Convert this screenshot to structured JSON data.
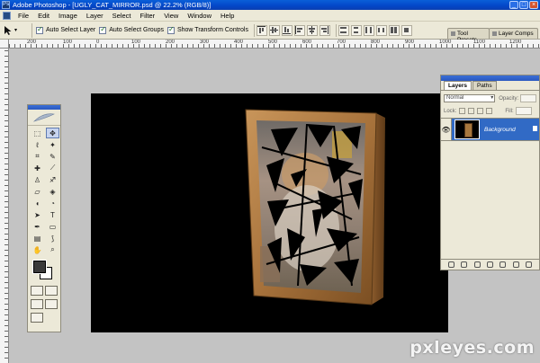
{
  "window": {
    "title": "Adobe Photoshop - [UGLY_CAT_MIRROR.psd @ 22.2% (RGB/8)]"
  },
  "menu": {
    "items": [
      "File",
      "Edit",
      "Image",
      "Layer",
      "Select",
      "Filter",
      "View",
      "Window",
      "Help"
    ]
  },
  "options": {
    "auto_select_layer": "Auto Select Layer",
    "auto_select_groups": "Auto Select Groups",
    "show_transform_controls": "Show Transform Controls",
    "tool_presets_tab": "Tool Presets",
    "layer_comps_tab": "Layer Comps"
  },
  "ruler": {
    "top_labels": [
      "200",
      "100",
      "0",
      "100",
      "200",
      "300",
      "400",
      "500",
      "600",
      "700",
      "800",
      "900",
      "1000",
      "1100",
      "1200"
    ]
  },
  "layers_panel": {
    "tabs": [
      "Layers",
      "Paths"
    ],
    "blend_mode": "Normal",
    "opacity_label": "Opacity:",
    "lock_label": "Lock:",
    "fill_label": "Fill:",
    "layer_name": "Background"
  },
  "colors": {
    "canvas": "#000000",
    "workspace": "#c3c3c3",
    "selection": "#316ac5"
  },
  "watermark": "pxleyes.com"
}
